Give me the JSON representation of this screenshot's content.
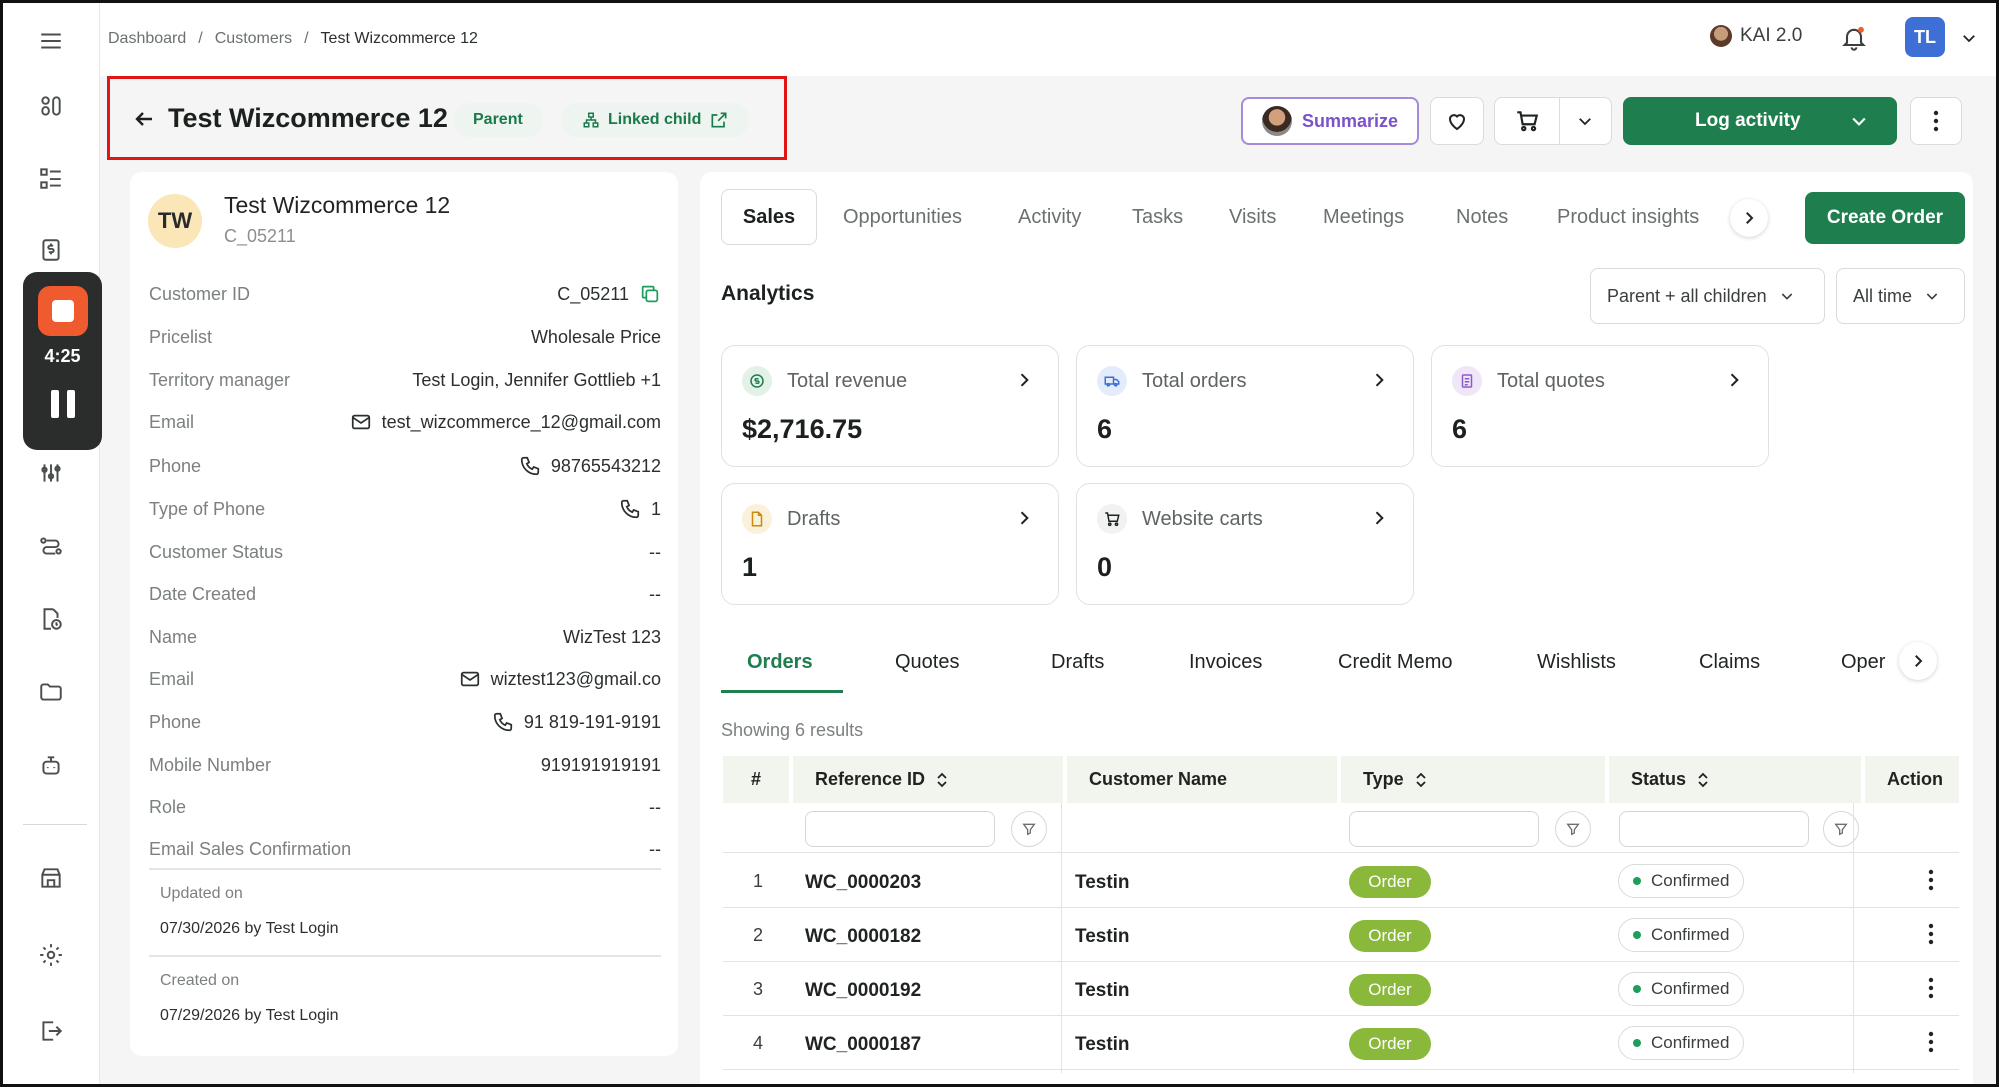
{
  "breadcrumb": {
    "items": [
      "Dashboard",
      "Customers",
      "Test Wizcommerce 12"
    ]
  },
  "topbar": {
    "kai_label": "KAI 2.0",
    "avatar_initials": "TL"
  },
  "recorder": {
    "time": "4:25"
  },
  "header": {
    "title": "Test Wizcommerce 12",
    "parent_pill": "Parent",
    "linked_child_pill": "Linked child",
    "summarize_label": "Summarize",
    "log_activity_label": "Log activity"
  },
  "customer": {
    "initials": "TW",
    "name": "Test Wizcommerce 12",
    "code": "C_05211",
    "fields": [
      {
        "label": "Customer ID",
        "value": "C_05211",
        "icon": "copy-icon"
      },
      {
        "label": "Pricelist",
        "value": "Wholesale Price"
      },
      {
        "label": "Territory manager",
        "value": "Test Login, Jennifer Gottlieb +1"
      },
      {
        "label": "Email",
        "value": "test_wizcommerce_12@gmail.com",
        "icon": "mail-icon"
      },
      {
        "label": "Phone",
        "value": "98765543212",
        "icon": "phone-icon"
      },
      {
        "label": "Type of Phone",
        "value": "1",
        "icon": "phone-icon"
      },
      {
        "label": "Customer Status",
        "value": "--"
      },
      {
        "label": "Date Created",
        "value": "--"
      },
      {
        "label": "Name",
        "value": "WizTest 123"
      },
      {
        "label": "Email",
        "value": "wiztest123@gmail.co",
        "icon": "mail-icon"
      },
      {
        "label": "Phone",
        "value": "91 819-191-9191",
        "icon": "phone-icon"
      },
      {
        "label": "Mobile Number",
        "value": "919191919191"
      },
      {
        "label": "Role",
        "value": "--"
      },
      {
        "label": "Email Sales Confirmation",
        "value": "--"
      }
    ],
    "updated_label": "Updated on",
    "updated_value": "07/30/2026 by Test Login",
    "created_label": "Created on",
    "created_value": "07/29/2026 by Test Login"
  },
  "main_tabs": [
    "Sales",
    "Opportunities",
    "Activity",
    "Tasks",
    "Visits",
    "Meetings",
    "Notes",
    "Product insights"
  ],
  "create_order_label": "Create Order",
  "analytics": {
    "title": "Analytics",
    "scope_dropdown": "Parent + all children",
    "time_dropdown": "All time",
    "stats": [
      {
        "label": "Total revenue",
        "value": "$2,716.75"
      },
      {
        "label": "Total orders",
        "value": "6"
      },
      {
        "label": "Total quotes",
        "value": "6"
      },
      {
        "label": "Drafts",
        "value": "1"
      },
      {
        "label": "Website carts",
        "value": "0"
      }
    ]
  },
  "sub_tabs": [
    "Orders",
    "Quotes",
    "Drafts",
    "Invoices",
    "Credit Memo",
    "Wishlists",
    "Claims",
    "Oper"
  ],
  "table": {
    "showing": "Showing 6 results",
    "headers": [
      "#",
      "Reference ID",
      "Customer Name",
      "Type",
      "Status",
      "Action"
    ],
    "rows": [
      {
        "num": "1",
        "ref": "WC_0000203",
        "customer": "Testin",
        "type": "Order",
        "status": "Confirmed"
      },
      {
        "num": "2",
        "ref": "WC_0000182",
        "customer": "Testin",
        "type": "Order",
        "status": "Confirmed"
      },
      {
        "num": "3",
        "ref": "WC_0000192",
        "customer": "Testin",
        "type": "Order",
        "status": "Confirmed"
      },
      {
        "num": "4",
        "ref": "WC_0000187",
        "customer": "Testin",
        "type": "Order",
        "status": "Confirmed"
      }
    ]
  },
  "colors": {
    "brand_green": "#1e7e4d",
    "order_badge": "#8ab83a",
    "highlight_box": "#e01616",
    "recorder_stop": "#ef5a2f"
  }
}
